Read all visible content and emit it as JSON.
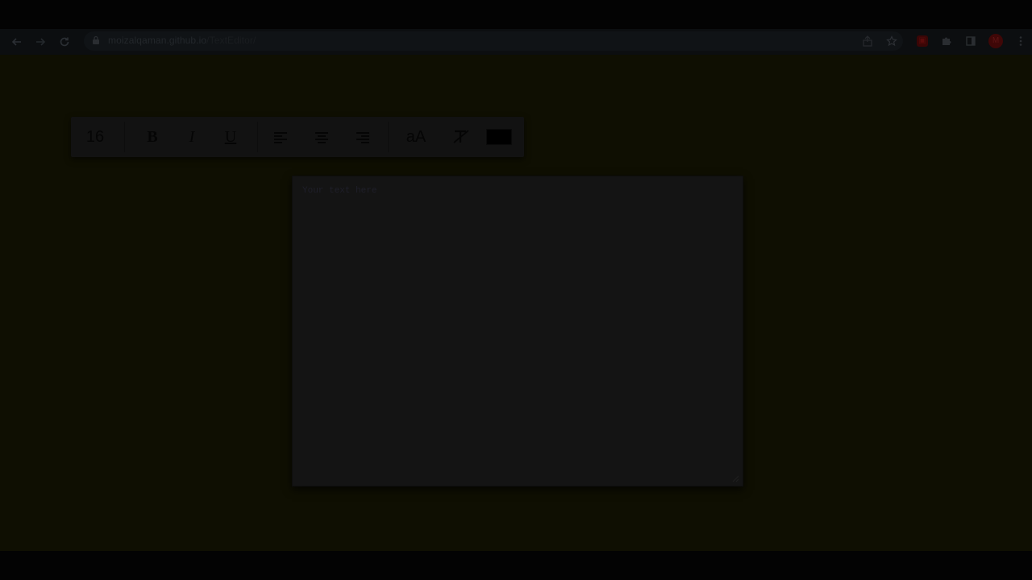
{
  "browser": {
    "url_host": "moizalqaman.github.io",
    "url_path": "/TextEditor/",
    "profile_initial": "M"
  },
  "toolbar": {
    "font_size": "16",
    "bold_label": "B",
    "italic_label": "I",
    "underline_label": "U",
    "case_label": "aA",
    "text_color": "#000000"
  },
  "editor": {
    "placeholder": "Your text here"
  },
  "colors": {
    "page_background": "#0f0f02",
    "toolbar_background": "#121212",
    "editor_background": "#141414"
  }
}
